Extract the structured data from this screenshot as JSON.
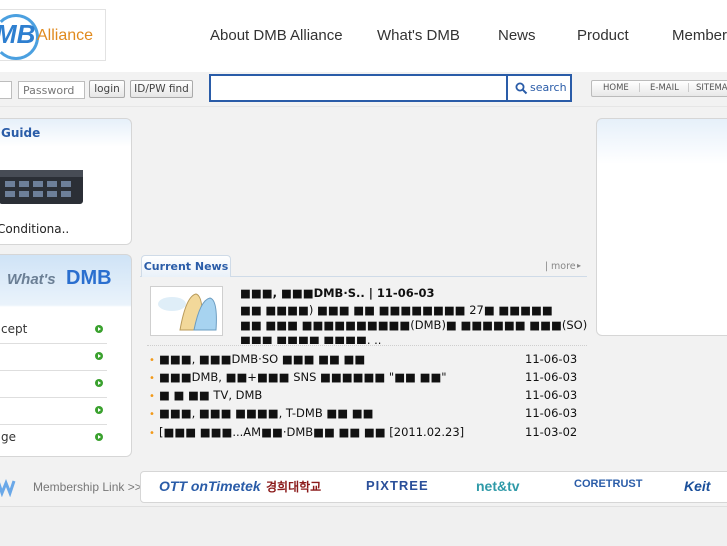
{
  "header": {
    "logo_text": "MB",
    "logo_suffix": "Alliance",
    "nav": [
      "About DMB Alliance",
      "What's DMB",
      "News",
      "Product",
      "Members"
    ]
  },
  "login": {
    "password_placeholder": "Password",
    "login_label": "login",
    "find_label": "ID/PW find"
  },
  "search": {
    "value": "",
    "button_label": "search"
  },
  "toplinks": [
    "HOME",
    "E-MAIL",
    "SITEMAP"
  ],
  "guide": {
    "title": "Guide",
    "caption": "Conditiona.."
  },
  "whats_dmb": {
    "title_prefix": "What's",
    "title_main": "DMB",
    "items": [
      "cept",
      "",
      "",
      "",
      "ge"
    ]
  },
  "news": {
    "tab": "Current News",
    "more": "more",
    "headline": "■■■, ■■■DMB·S.. | 11-06-03",
    "summary": [
      "■■ ■■■■) ■■■ ■■ ■■■■■■■■ 27■ ■■■■■",
      "■■ ■■■ ■■■■■■■■■■(DMB)■ ■■■■■■ ■■■(SO)",
      "■■■ ■■■■ ■■■■. .."
    ],
    "rows": [
      {
        "text": "■■■, ■■■DMB·SO ■■■ ■■ ■■",
        "date": "11-06-03"
      },
      {
        "text": "■■■DMB, ■■+■■■ SNS ■■■■■■ \"■■ ■■\"",
        "date": "11-06-03"
      },
      {
        "text": "■ ■ ■■ TV, DMB",
        "date": "11-06-03"
      },
      {
        "text": "■■■, ■■■ ■■■■, T-DMB ■■ ■■",
        "date": "11-06-03"
      },
      {
        "text": "[■■■ ■■■...AM■■·DMB■■ ■■ ■■ [2011.02.23]",
        "date": "11-03-02"
      }
    ]
  },
  "membership": {
    "label": "Membership Link >>",
    "logos": [
      "OTT onTimetek",
      "경희대학교",
      "PIXTREE",
      "net&tv",
      "CORETRUST",
      "Keit"
    ]
  },
  "colors": {
    "brand_blue": "#2a5ca8",
    "accent_orange": "#f29a1a",
    "menu_green": "#3aa12e"
  }
}
